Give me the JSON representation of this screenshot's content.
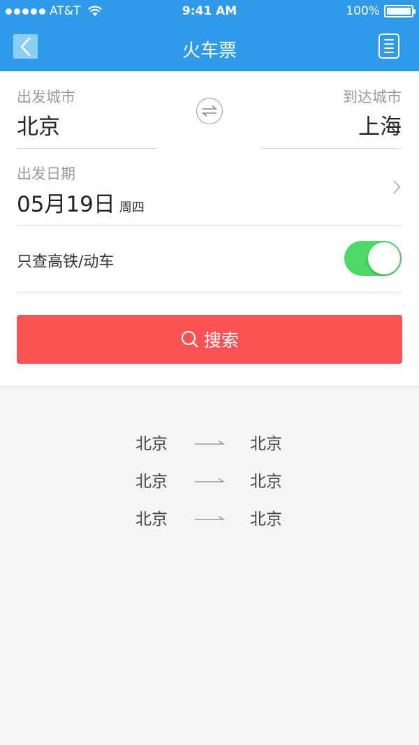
{
  "status_bar": {
    "carrier": "AT&T",
    "time": "9:41 AM",
    "battery": "100%"
  },
  "nav": {
    "title": "火车票"
  },
  "form": {
    "from_label": "出发城市",
    "from_city": "北京",
    "to_label": "到达城市",
    "to_city": "上海",
    "date_label": "出发日期",
    "date": "05月19日",
    "weekday": "周四",
    "highspeed_label": "只查高铁/动车",
    "highspeed_on": true,
    "search_label": "搜索"
  },
  "colors": {
    "header": "#2e9ae8",
    "toggle_on": "#4cd964",
    "search": "#fd5355"
  },
  "history": [
    {
      "from": "北京",
      "to": "北京"
    },
    {
      "from": "北京",
      "to": "北京"
    },
    {
      "from": "北京",
      "to": "北京"
    }
  ]
}
